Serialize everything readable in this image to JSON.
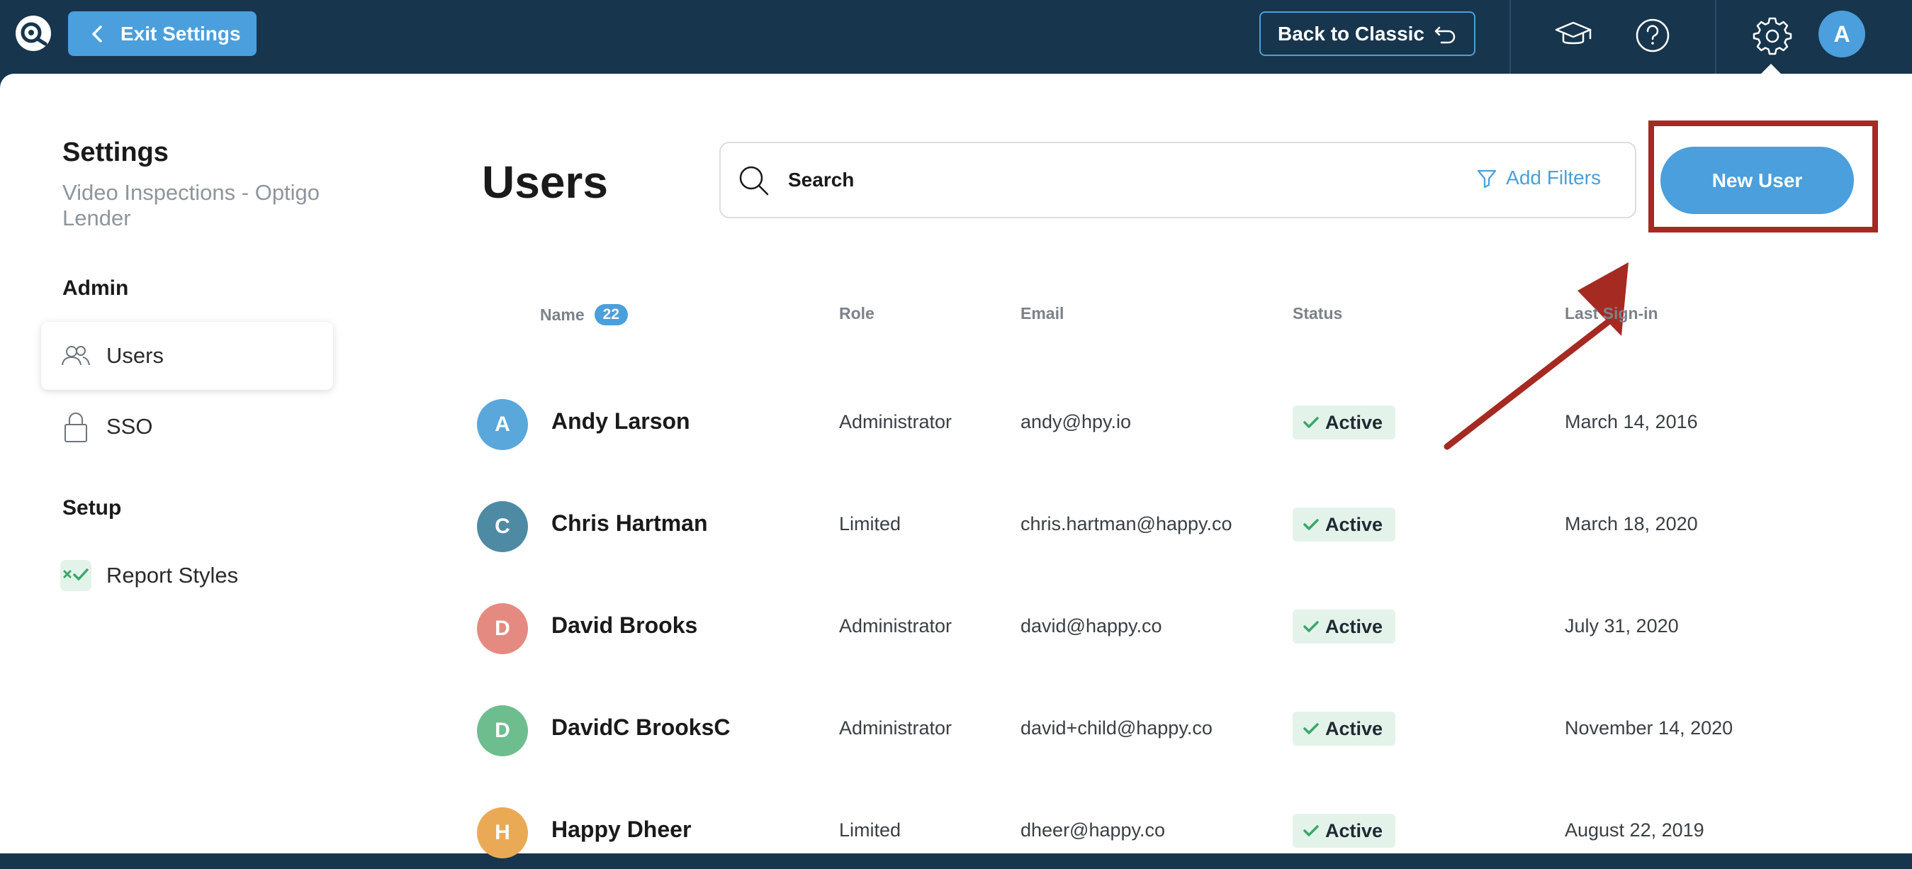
{
  "topbar": {
    "exit_label": "Exit Settings",
    "classic_label": "Back to Classic",
    "avatar_initial": "A",
    "icons": [
      "app-logo-icon",
      "chevron-left-icon",
      "undo-arrow-icon",
      "graduation-cap-icon",
      "help-icon",
      "gear-icon"
    ]
  },
  "sidebar": {
    "title": "Settings",
    "subtitle": "Video Inspections - Optigo Lender",
    "sections": [
      {
        "label": "Admin",
        "items": [
          {
            "label": "Users",
            "icon": "users-icon",
            "active": true
          },
          {
            "label": "SSO",
            "icon": "lock-icon",
            "active": false
          }
        ]
      },
      {
        "label": "Setup",
        "items": [
          {
            "label": "Report Styles",
            "icon": "report-styles-icon",
            "active": false
          }
        ]
      }
    ]
  },
  "main": {
    "title": "Users",
    "search_placeholder": "Search",
    "add_filters_label": "Add Filters",
    "new_user_label": "New User",
    "columns": {
      "name": "Name",
      "count": "22",
      "role": "Role",
      "email": "Email",
      "status": "Status",
      "last_signin": "Last Sign-in"
    },
    "users": [
      {
        "initial": "A",
        "name": "Andy Larson",
        "role": "Administrator",
        "email": "andy@hpy.io",
        "status": "Active",
        "last_signin": "March 14, 2016",
        "color": "#5aa7db"
      },
      {
        "initial": "C",
        "name": "Chris Hartman",
        "role": "Limited",
        "email": "chris.hartman@happy.co",
        "status": "Active",
        "last_signin": "March 18, 2020",
        "color": "#4f8aa5"
      },
      {
        "initial": "D",
        "name": "David Brooks",
        "role": "Administrator",
        "email": "david@happy.co",
        "status": "Active",
        "last_signin": "July 31, 2020",
        "color": "#e58a80"
      },
      {
        "initial": "D",
        "name": "DavidC BrooksC",
        "role": "Administrator",
        "email": "david+child@happy.co",
        "status": "Active",
        "last_signin": "November 14, 2020",
        "color": "#6dbd8f"
      },
      {
        "initial": "H",
        "name": "Happy Dheer",
        "role": "Limited",
        "email": "dheer@happy.co",
        "status": "Active",
        "last_signin": "August 22, 2019",
        "color": "#eaaa55"
      }
    ]
  },
  "colors": {
    "topbar": "#17354d",
    "accent": "#4a9fdc",
    "highlight": "#a52a22",
    "active_badge": "#e4f3ea",
    "check": "#3aa86a"
  }
}
